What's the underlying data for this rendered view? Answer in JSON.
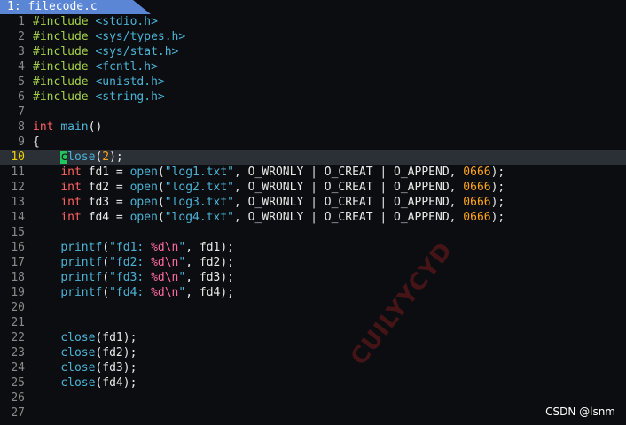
{
  "tabline": {
    "label": "1: filecode.c"
  },
  "lines": [
    {
      "n": "1",
      "spans": [
        [
          "pp",
          "#include "
        ],
        [
          "hdr",
          "<stdio.h>"
        ]
      ]
    },
    {
      "n": "2",
      "spans": [
        [
          "pp",
          "#include "
        ],
        [
          "hdr",
          "<sys/types.h>"
        ]
      ]
    },
    {
      "n": "3",
      "spans": [
        [
          "pp",
          "#include "
        ],
        [
          "hdr",
          "<sys/stat.h>"
        ]
      ]
    },
    {
      "n": "4",
      "spans": [
        [
          "pp",
          "#include "
        ],
        [
          "hdr",
          "<fcntl.h>"
        ]
      ]
    },
    {
      "n": "5",
      "spans": [
        [
          "pp",
          "#include "
        ],
        [
          "hdr",
          "<unistd.h>"
        ]
      ]
    },
    {
      "n": "6",
      "spans": [
        [
          "pp",
          "#include "
        ],
        [
          "hdr",
          "<string.h>"
        ]
      ]
    },
    {
      "n": "7",
      "spans": []
    },
    {
      "n": "8",
      "spans": [
        [
          "kw",
          "int "
        ],
        [
          "fn",
          "main"
        ],
        [
          "plain",
          "()"
        ]
      ]
    },
    {
      "n": "9",
      "spans": [
        [
          "plain",
          "{"
        ]
      ]
    },
    {
      "n": "10",
      "cursorline": true,
      "spans": [
        [
          "plain",
          "    "
        ],
        [
          "cursor",
          "c"
        ],
        [
          "fn",
          "lose"
        ],
        [
          "plain",
          "("
        ],
        [
          "num",
          "2"
        ],
        [
          "plain",
          ");"
        ]
      ]
    },
    {
      "n": "11",
      "spans": [
        [
          "plain",
          "    "
        ],
        [
          "kw",
          "int "
        ],
        [
          "plain",
          "fd1 = "
        ],
        [
          "fn",
          "open"
        ],
        [
          "plain",
          "("
        ],
        [
          "str",
          "\"log1.txt\""
        ],
        [
          "plain",
          ", O_WRONLY | O_CREAT | O_APPEND, "
        ],
        [
          "num",
          "0666"
        ],
        [
          "plain",
          ");"
        ]
      ]
    },
    {
      "n": "12",
      "spans": [
        [
          "plain",
          "    "
        ],
        [
          "kw",
          "int "
        ],
        [
          "plain",
          "fd2 = "
        ],
        [
          "fn",
          "open"
        ],
        [
          "plain",
          "("
        ],
        [
          "str",
          "\"log2.txt\""
        ],
        [
          "plain",
          ", O_WRONLY | O_CREAT | O_APPEND, "
        ],
        [
          "num",
          "0666"
        ],
        [
          "plain",
          ");"
        ]
      ]
    },
    {
      "n": "13",
      "spans": [
        [
          "plain",
          "    "
        ],
        [
          "kw",
          "int "
        ],
        [
          "plain",
          "fd3 = "
        ],
        [
          "fn",
          "open"
        ],
        [
          "plain",
          "("
        ],
        [
          "str",
          "\"log3.txt\""
        ],
        [
          "plain",
          ", O_WRONLY | O_CREAT | O_APPEND, "
        ],
        [
          "num",
          "0666"
        ],
        [
          "plain",
          ");"
        ]
      ]
    },
    {
      "n": "14",
      "spans": [
        [
          "plain",
          "    "
        ],
        [
          "kw",
          "int "
        ],
        [
          "plain",
          "fd4 = "
        ],
        [
          "fn",
          "open"
        ],
        [
          "plain",
          "("
        ],
        [
          "str",
          "\"log4.txt\""
        ],
        [
          "plain",
          ", O_WRONLY | O_CREAT | O_APPEND, "
        ],
        [
          "num",
          "0666"
        ],
        [
          "plain",
          ");"
        ]
      ]
    },
    {
      "n": "15",
      "spans": []
    },
    {
      "n": "16",
      "spans": [
        [
          "plain",
          "    "
        ],
        [
          "fn",
          "printf"
        ],
        [
          "plain",
          "("
        ],
        [
          "str",
          "\"fd1: "
        ],
        [
          "fmt",
          "%d\\n"
        ],
        [
          "str",
          "\""
        ],
        [
          "plain",
          ", fd1);"
        ]
      ]
    },
    {
      "n": "17",
      "spans": [
        [
          "plain",
          "    "
        ],
        [
          "fn",
          "printf"
        ],
        [
          "plain",
          "("
        ],
        [
          "str",
          "\"fd2: "
        ],
        [
          "fmt",
          "%d\\n"
        ],
        [
          "str",
          "\""
        ],
        [
          "plain",
          ", fd2);"
        ]
      ]
    },
    {
      "n": "18",
      "spans": [
        [
          "plain",
          "    "
        ],
        [
          "fn",
          "printf"
        ],
        [
          "plain",
          "("
        ],
        [
          "str",
          "\"fd3: "
        ],
        [
          "fmt",
          "%d\\n"
        ],
        [
          "str",
          "\""
        ],
        [
          "plain",
          ", fd3);"
        ]
      ]
    },
    {
      "n": "19",
      "spans": [
        [
          "plain",
          "    "
        ],
        [
          "fn",
          "printf"
        ],
        [
          "plain",
          "("
        ],
        [
          "str",
          "\"fd4: "
        ],
        [
          "fmt",
          "%d\\n"
        ],
        [
          "str",
          "\""
        ],
        [
          "plain",
          ", fd4);"
        ]
      ]
    },
    {
      "n": "20",
      "spans": []
    },
    {
      "n": "21",
      "spans": []
    },
    {
      "n": "22",
      "spans": [
        [
          "plain",
          "    "
        ],
        [
          "fn",
          "close"
        ],
        [
          "plain",
          "(fd1);"
        ]
      ]
    },
    {
      "n": "23",
      "spans": [
        [
          "plain",
          "    "
        ],
        [
          "fn",
          "close"
        ],
        [
          "plain",
          "(fd2);"
        ]
      ]
    },
    {
      "n": "24",
      "spans": [
        [
          "plain",
          "    "
        ],
        [
          "fn",
          "close"
        ],
        [
          "plain",
          "(fd3);"
        ]
      ]
    },
    {
      "n": "25",
      "spans": [
        [
          "plain",
          "    "
        ],
        [
          "fn",
          "close"
        ],
        [
          "plain",
          "(fd4);"
        ]
      ]
    },
    {
      "n": "26",
      "spans": []
    },
    {
      "n": "27",
      "spans": []
    }
  ],
  "watermark": "CUILYYCYD",
  "credit": "CSDN @lsnm",
  "colors": {
    "background": "#0b0d10",
    "tabline": "#5b86d6",
    "preprocessor": "#a6d24a",
    "keyword": "#ff6060",
    "function": "#4bb3d6",
    "number": "#ffa31a",
    "format": "#ff6aa0",
    "cursor": "#22c55e"
  }
}
